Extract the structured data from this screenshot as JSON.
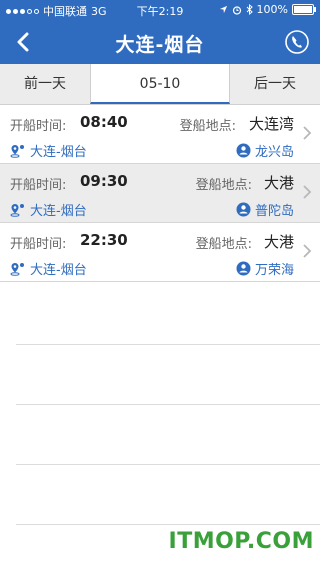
{
  "status": {
    "carrier": "中国联通",
    "network": "3G",
    "time": "下午2:19",
    "battery": "100%"
  },
  "nav": {
    "title": "大连-烟台"
  },
  "datebar": {
    "prev": "前一天",
    "current": "05-10",
    "next": "后一天"
  },
  "labels": {
    "departure": "开船时间:",
    "boarding": "登船地点:"
  },
  "rows": [
    {
      "time": "08:40",
      "port": "大连湾",
      "route": "大连-烟台",
      "ship": "龙兴岛"
    },
    {
      "time": "09:30",
      "port": "大港",
      "route": "大连-烟台",
      "ship": "普陀岛"
    },
    {
      "time": "22:30",
      "port": "大港",
      "route": "大连-烟台",
      "ship": "万荣海"
    }
  ],
  "watermark": "ITMOP.COM",
  "colors": {
    "primary": "#2f6cc0",
    "watermark": "#3aa03a"
  }
}
